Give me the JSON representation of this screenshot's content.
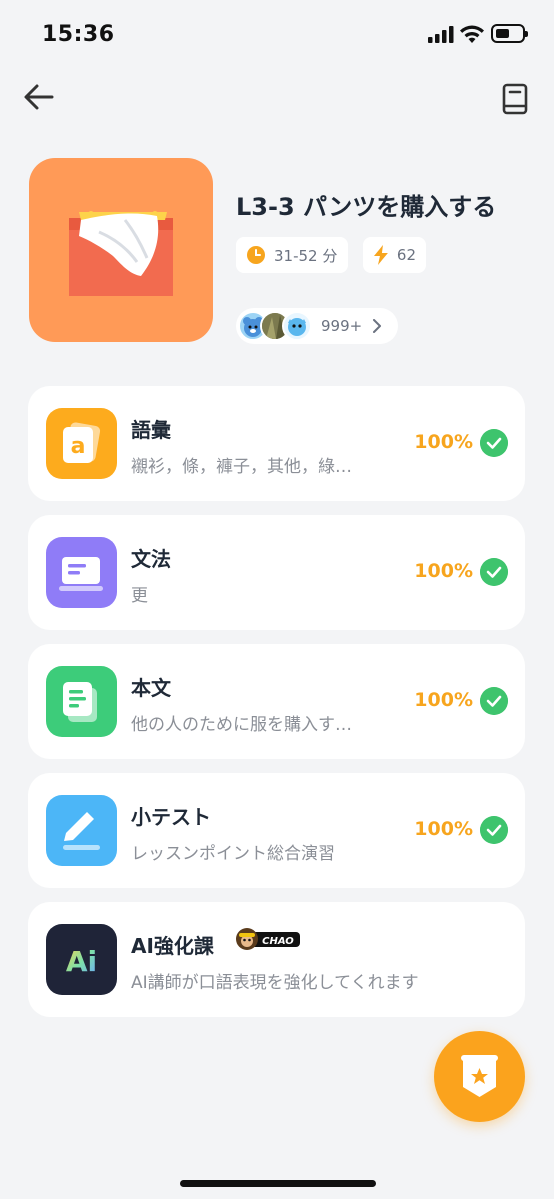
{
  "status_bar": {
    "time": "15:36"
  },
  "header": {
    "back_icon": "arrow-left-icon",
    "book_icon": "book-icon"
  },
  "lesson": {
    "title": "L3-3 パンツを購入する",
    "duration": "31-52 分",
    "energy": "62",
    "learners_count": "999+"
  },
  "sections": [
    {
      "title": "語彙",
      "subtitle": "襯衫，條，褲子，其他，綠…",
      "progress": "100%",
      "completed": true,
      "icon": "vocabulary-icon",
      "color": "#fdab1d"
    },
    {
      "title": "文法",
      "subtitle": "更",
      "progress": "100%",
      "completed": true,
      "icon": "grammar-icon",
      "color": "#8f7cf7"
    },
    {
      "title": "本文",
      "subtitle": "他の人のために服を購入す…",
      "progress": "100%",
      "completed": true,
      "icon": "text-icon",
      "color": "#3dcc7a"
    },
    {
      "title": "小テスト",
      "subtitle": "レッスンポイント総合演習",
      "progress": "100%",
      "completed": true,
      "icon": "quiz-icon",
      "color": "#4cb6f7"
    },
    {
      "title": "AI強化課",
      "subtitle": "AI講師が口語表現を強化してくれます",
      "badge": "CHAO",
      "icon": "ai-icon",
      "color": "#1f2438"
    }
  ],
  "accent": {
    "progress": "#f7a51e",
    "check": "#3ec46d",
    "fab": "#fba31d"
  }
}
